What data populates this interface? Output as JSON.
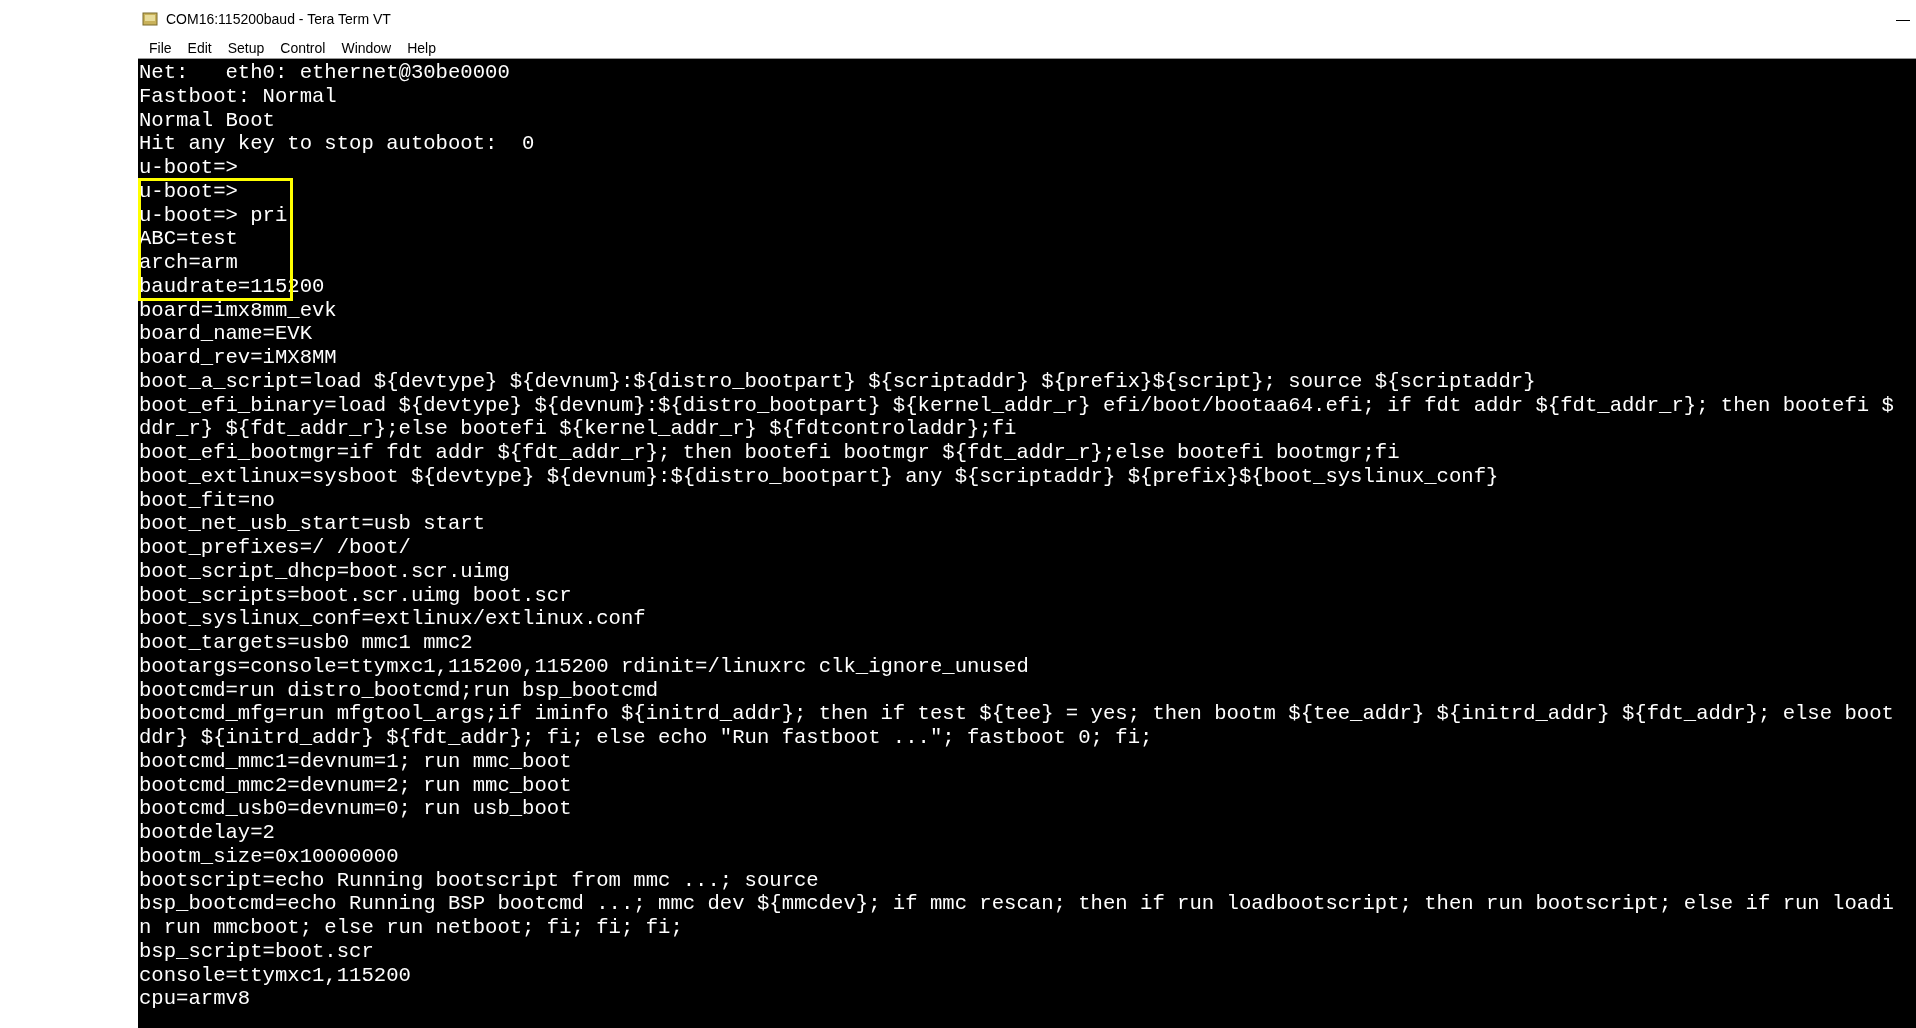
{
  "window": {
    "title": "COM16:115200baud - Tera Term VT",
    "minimize": "—"
  },
  "menu": [
    {
      "label": "File"
    },
    {
      "label": "Edit"
    },
    {
      "label": "Setup"
    },
    {
      "label": "Control"
    },
    {
      "label": "Window"
    },
    {
      "label": "Help"
    }
  ],
  "terminal": {
    "lines": [
      {
        "text": "Net:   eth0: ethernet@30be0000",
        "highlighted": false
      },
      {
        "text": "Fastboot: Normal",
        "highlighted": false
      },
      {
        "text": "Normal Boot",
        "highlighted": false
      },
      {
        "text": "Hit any key to stop autoboot:  0",
        "highlighted": false
      },
      {
        "text": "u-boot=>",
        "highlighted": false
      },
      {
        "text": "u-boot=>",
        "highlighted": true
      },
      {
        "text": "u-boot=> pri",
        "highlighted": true
      },
      {
        "text": "ABC=test",
        "highlighted": true
      },
      {
        "text": "arch=arm",
        "highlighted": true
      },
      {
        "text": "baudrate=115200",
        "highlighted": true
      },
      {
        "text": "board=imx8mm_evk",
        "highlighted": false
      },
      {
        "text": "board_name=EVK",
        "highlighted": false
      },
      {
        "text": "board_rev=iMX8MM",
        "highlighted": false
      },
      {
        "text": "boot_a_script=load ${devtype} ${devnum}:${distro_bootpart} ${scriptaddr} ${prefix}${script}; source ${scriptaddr}",
        "highlighted": false
      },
      {
        "text": "boot_efi_binary=load ${devtype} ${devnum}:${distro_bootpart} ${kernel_addr_r} efi/boot/bootaa64.efi; if fdt addr ${fdt_addr_r}; then bootefi $",
        "highlighted": false
      },
      {
        "text": "ddr_r} ${fdt_addr_r};else bootefi ${kernel_addr_r} ${fdtcontroladdr};fi",
        "highlighted": false
      },
      {
        "text": "boot_efi_bootmgr=if fdt addr ${fdt_addr_r}; then bootefi bootmgr ${fdt_addr_r};else bootefi bootmgr;fi",
        "highlighted": false
      },
      {
        "text": "boot_extlinux=sysboot ${devtype} ${devnum}:${distro_bootpart} any ${scriptaddr} ${prefix}${boot_syslinux_conf}",
        "highlighted": false
      },
      {
        "text": "boot_fit=no",
        "highlighted": false
      },
      {
        "text": "boot_net_usb_start=usb start",
        "highlighted": false
      },
      {
        "text": "boot_prefixes=/ /boot/",
        "highlighted": false
      },
      {
        "text": "boot_script_dhcp=boot.scr.uimg",
        "highlighted": false
      },
      {
        "text": "boot_scripts=boot.scr.uimg boot.scr",
        "highlighted": false
      },
      {
        "text": "boot_syslinux_conf=extlinux/extlinux.conf",
        "highlighted": false
      },
      {
        "text": "boot_targets=usb0 mmc1 mmc2",
        "highlighted": false
      },
      {
        "text": "bootargs=console=ttymxc1,115200,115200 rdinit=/linuxrc clk_ignore_unused",
        "highlighted": false
      },
      {
        "text": "bootcmd=run distro_bootcmd;run bsp_bootcmd",
        "highlighted": false
      },
      {
        "text": "bootcmd_mfg=run mfgtool_args;if iminfo ${initrd_addr}; then if test ${tee} = yes; then bootm ${tee_addr} ${initrd_addr} ${fdt_addr}; else boot",
        "highlighted": false
      },
      {
        "text": "ddr} ${initrd_addr} ${fdt_addr}; fi; else echo \"Run fastboot ...\"; fastboot 0; fi;",
        "highlighted": false
      },
      {
        "text": "bootcmd_mmc1=devnum=1; run mmc_boot",
        "highlighted": false
      },
      {
        "text": "bootcmd_mmc2=devnum=2; run mmc_boot",
        "highlighted": false
      },
      {
        "text": "bootcmd_usb0=devnum=0; run usb_boot",
        "highlighted": false
      },
      {
        "text": "bootdelay=2",
        "highlighted": false
      },
      {
        "text": "bootm_size=0x10000000",
        "highlighted": false
      },
      {
        "text": "bootscript=echo Running bootscript from mmc ...; source",
        "highlighted": false
      },
      {
        "text": "bsp_bootcmd=echo Running BSP bootcmd ...; mmc dev ${mmcdev}; if mmc rescan; then if run loadbootscript; then run bootscript; else if run loadi",
        "highlighted": false
      },
      {
        "text": "n run mmcboot; else run netboot; fi; fi; fi;",
        "highlighted": false
      },
      {
        "text": "bsp_script=boot.scr",
        "highlighted": false
      },
      {
        "text": "console=ttymxc1,115200",
        "highlighted": false
      },
      {
        "text": "cpu=armv8",
        "highlighted": false
      }
    ]
  }
}
